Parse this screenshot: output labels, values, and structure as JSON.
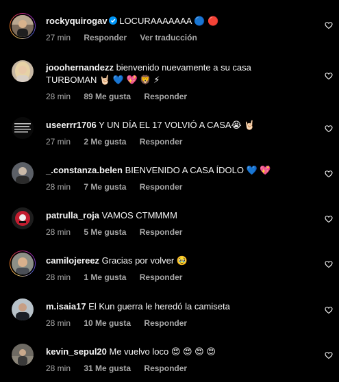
{
  "comments": [
    {
      "username": "rockyquirogav",
      "verified": true,
      "text": "LOCURAAAAAAA 🔵 🔴",
      "time": "27 min",
      "likes": "",
      "reply": "Responder",
      "translate": "Ver traducción",
      "avatar_icon": "profile-photo"
    },
    {
      "username": "jooohernandezz",
      "verified": false,
      "text": "bienvenido nuevamente a su casa",
      "text2": "TURBOMAN 🤘🏻 💙 💖 🦁 ⚡",
      "time": "28 min",
      "likes": "89 Me gusta",
      "reply": "Responder",
      "avatar_icon": "profile-photo"
    },
    {
      "username": "useerrr1706",
      "verified": false,
      "text": "Y UN DÍA EL 17 VOLVIÓ A CASA😭 🤘🏻",
      "time": "27 min",
      "likes": "2 Me gusta",
      "reply": "Responder",
      "avatar_icon": "profile-photo"
    },
    {
      "username": "_.constanza.belen",
      "verified": false,
      "text": "BIENVENIDO A CASA ÍDOLO 💙 💖",
      "time": "28 min",
      "likes": "7 Me gusta",
      "reply": "Responder",
      "avatar_icon": "profile-photo"
    },
    {
      "username": "patrulla_roja",
      "verified": false,
      "text": "VAMOS CTMMMM",
      "time": "28 min",
      "likes": "5 Me gusta",
      "reply": "Responder",
      "avatar_icon": "profile-photo"
    },
    {
      "username": "camilojereez",
      "verified": false,
      "text": "Gracias por volver 🥹",
      "time": "28 min",
      "likes": "1 Me gusta",
      "reply": "Responder",
      "avatar_icon": "profile-photo"
    },
    {
      "username": "m.isaia17",
      "verified": false,
      "text": "El Kun guerra le heredó la camiseta",
      "time": "28 min",
      "likes": "10 Me gusta",
      "reply": "Responder",
      "avatar_icon": "profile-photo"
    },
    {
      "username": "kevin_sepul20",
      "verified": false,
      "text": "Me vuelvo loco 😍 😍 😍 😍",
      "time": "28 min",
      "likes": "31 Me gusta",
      "reply": "Responder",
      "avatar_icon": "profile-photo"
    }
  ],
  "colors": {
    "background": "#000000",
    "text": "#f5f5f5",
    "secondary": "#a8a8a8",
    "verified": "#0095f6"
  }
}
